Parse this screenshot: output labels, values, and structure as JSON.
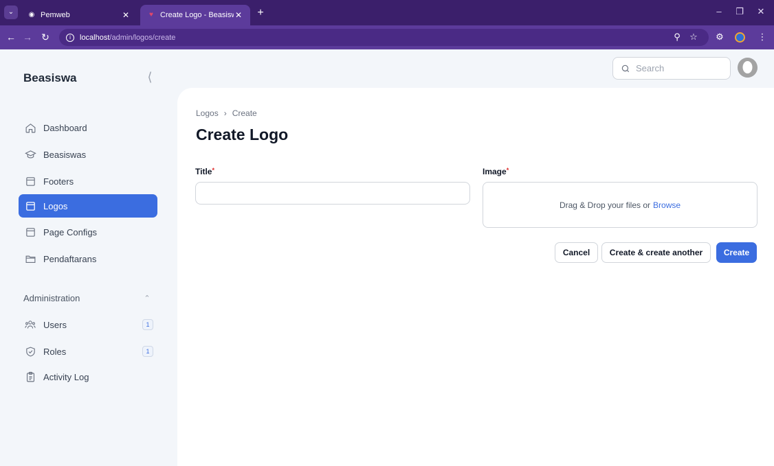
{
  "browser": {
    "tabs": [
      {
        "title": "Pemweb",
        "active": false
      },
      {
        "title": "Create Logo - Beasiswa",
        "active": true
      }
    ],
    "url_host": "localhost",
    "url_path": "/admin/logos/create",
    "theme_color": "#5c3b9b"
  },
  "sidebar": {
    "brand": "Beasiswa",
    "items": [
      {
        "label": "Dashboard",
        "icon": "home-icon",
        "active": false
      },
      {
        "label": "Beasiswas",
        "icon": "graduation-cap-icon",
        "active": false
      },
      {
        "label": "Footers",
        "icon": "archive-box-icon",
        "active": false
      },
      {
        "label": "Logos",
        "icon": "archive-box-icon",
        "active": true
      },
      {
        "label": "Page Configs",
        "icon": "archive-box-icon",
        "active": false
      },
      {
        "label": "Pendaftarans",
        "icon": "folder-icon",
        "active": false
      }
    ],
    "admin_section": {
      "label": "Administration",
      "items": [
        {
          "label": "Users",
          "icon": "users-icon",
          "badge": "1"
        },
        {
          "label": "Roles",
          "icon": "shield-check-icon",
          "badge": "1"
        },
        {
          "label": "Activity Log",
          "icon": "clipboard-icon",
          "badge": null
        }
      ]
    },
    "accent_color": "#3b6de0"
  },
  "topbar": {
    "search_placeholder": "Search"
  },
  "main": {
    "breadcrumb": [
      "Logos",
      "Create"
    ],
    "title": "Create Logo",
    "form": {
      "title_label": "Title",
      "title_value": "",
      "image_label": "Image",
      "required_marker": "*",
      "dropzone_text": "Drag & Drop your files or",
      "dropzone_link": "Browse"
    },
    "actions": {
      "cancel": "Cancel",
      "create_another": "Create & create another",
      "create": "Create"
    }
  }
}
